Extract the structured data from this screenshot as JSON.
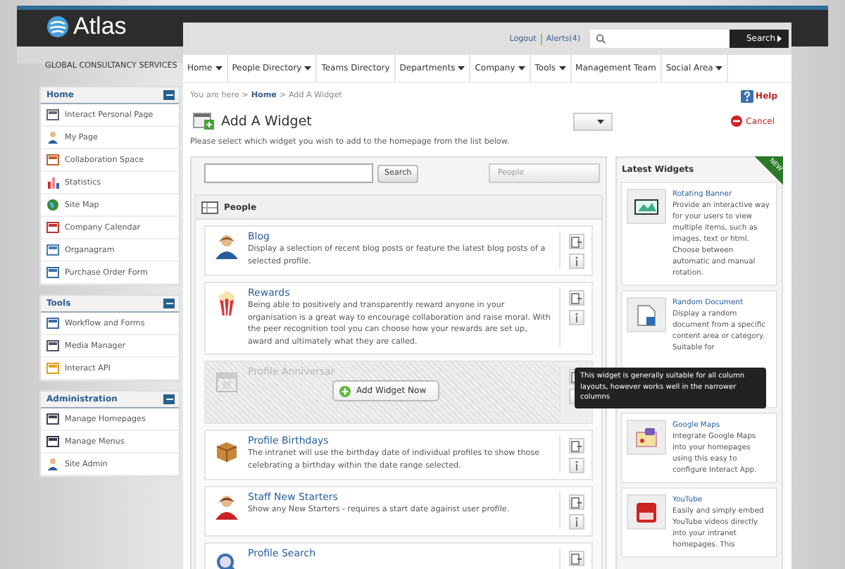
{
  "brand": {
    "name": "Atlas",
    "tagline": "GLOBAL CONSULTANCY SERVICES"
  },
  "topbar": {
    "links": [
      "Logout",
      "Alerts(4)"
    ],
    "search_button": "Search"
  },
  "nav": [
    {
      "label": "Home",
      "has_menu": true
    },
    {
      "label": "People Directory",
      "has_menu": true
    },
    {
      "label": "Teams Directory",
      "has_menu": false
    },
    {
      "label": "Departments",
      "has_menu": true
    },
    {
      "label": "Company",
      "has_menu": true
    },
    {
      "label": "Tools",
      "has_menu": true
    },
    {
      "label": "Management Team",
      "has_menu": false
    },
    {
      "label": "Social Area",
      "has_menu": true
    }
  ],
  "sidebar": [
    {
      "title": "Home",
      "expanded": true,
      "items": [
        "Interact Personal Page",
        "My Page",
        "Collaboration Space",
        "Statistics",
        "Site Map",
        "Company Calendar",
        "Organagram",
        "Purchase Order Form"
      ]
    },
    {
      "title": "Tools",
      "expanded": true,
      "items": [
        "Workflow and Forms",
        "Media Manager",
        "Interact API"
      ]
    },
    {
      "title": "Administration",
      "expanded": true,
      "items": [
        "Manage Homepages",
        "Manage Menus",
        "Site Admin"
      ]
    }
  ],
  "breadcrumb": {
    "prefix": "You are here >",
    "home": "Home",
    "current": "> Add A Widget"
  },
  "help": "Help",
  "title": "Add A Widget",
  "cancel": "Cancel",
  "instruction": "Please select which widget you wish to add to the homepage from the list below.",
  "filter": {
    "search_button": "Search",
    "category": "People"
  },
  "group": {
    "title": "People"
  },
  "widgets": [
    {
      "title": "Blog",
      "description": "Display a selection of recent blog posts or feature the latest blog posts of a selected profile.",
      "hovered": false
    },
    {
      "title": "Rewards",
      "description": "Being able to positively and transparently reward anyone in your organisation is a great way to encourage collaboration and raise moral. With the peer recognition tool you can choose how your rewards are set up, award and ultimately what they are called.",
      "hovered": false
    },
    {
      "title": "Profile Anniversar",
      "hovered": true,
      "hover_button": "Add Widget Now"
    },
    {
      "title": "Profile Birthdays",
      "description": "The intranet will use the birthday date of individual profiles to show those celebrating a birthday within the date range selected.",
      "hovered": false
    },
    {
      "title": "Staff New Starters",
      "description": "Show any New Starters - requires a start date against user profile.",
      "hovered": false
    },
    {
      "title": "Profile Search",
      "hovered": false
    }
  ],
  "latest": {
    "title": "Latest Widgets",
    "ribbon": "NEW",
    "items": [
      {
        "title": "Rotating Banner",
        "description": "Provide an interactive way for your users to view multiple items, such as images, text or html. Choose between automatic and manual rotation."
      },
      {
        "title": "Random Document",
        "description": "Display a random document from a specific content area or category. Suitable for"
      },
      {
        "title": "Google Maps",
        "description": "Integrate Google Maps into your homepages using this easy to configure Interact App."
      },
      {
        "title": "YouTube",
        "description": "Easily and simply embed YouTube videos directly into your intranet homepages. This"
      }
    ]
  },
  "tooltip": {
    "text": "This widget is generally suitable for all column layouts, however works well in the narrower columns"
  }
}
